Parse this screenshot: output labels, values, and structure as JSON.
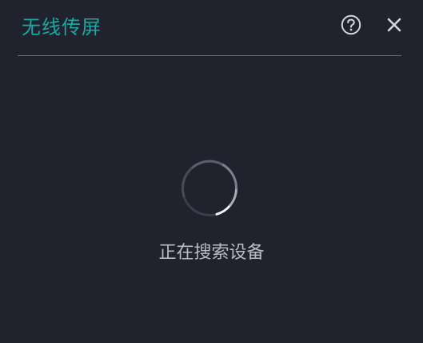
{
  "dialog": {
    "title": "无线传屏",
    "status_text": "正在搜索设备"
  },
  "icons": {
    "help": "help-circle-icon",
    "close": "close-icon",
    "spinner": "loading-spinner-icon"
  },
  "colors": {
    "background": "#20232d",
    "title": "#19a8a4",
    "divider": "#6c7080",
    "status_text": "#b8bcc4",
    "icon": "#d3d6dc",
    "spinner_head": "#f2f3f5",
    "spinner_tail": "#3a3e4a"
  }
}
